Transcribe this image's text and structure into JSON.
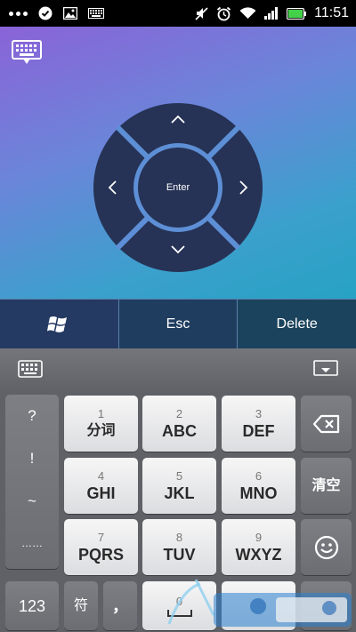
{
  "status_bar": {
    "time": "11:51",
    "left_icons": [
      "more-dots-icon",
      "check-circle-icon",
      "image-icon",
      "keyboard-icon"
    ],
    "right_icons": [
      "mute-icon",
      "alarm-icon",
      "wifi-icon",
      "signal-icon",
      "battery-icon"
    ]
  },
  "remote": {
    "dpad": {
      "center_label": "Enter",
      "up_icon": "chevron-up-icon",
      "down_icon": "chevron-down-icon",
      "left_icon": "chevron-left-icon",
      "right_icon": "chevron-right-icon"
    },
    "function_keys": {
      "windows_icon": "windows-logo-icon",
      "esc_label": "Esc",
      "delete_label": "Delete"
    }
  },
  "keyboard": {
    "symbols": [
      "?",
      "!",
      "~",
      "……"
    ],
    "keys": [
      {
        "num": "1",
        "label": "分词"
      },
      {
        "num": "2",
        "label": "ABC"
      },
      {
        "num": "3",
        "label": "DEF"
      },
      {
        "num": "4",
        "label": "GHI"
      },
      {
        "num": "5",
        "label": "JKL"
      },
      {
        "num": "6",
        "label": "MNO"
      },
      {
        "num": "7",
        "label": "PQRS"
      },
      {
        "num": "8",
        "label": "TUV"
      },
      {
        "num": "9",
        "label": "WXYZ"
      }
    ],
    "clear_label": "清空",
    "numeric_label": "123",
    "symbol_label": "符",
    "comma_label": "，",
    "space_num": "0"
  },
  "colors": {
    "gradient_start": "#8a63d8",
    "gradient_end": "#27a2c4",
    "dpad_fill": "#263356",
    "dpad_ring": "#5d8fd6"
  }
}
